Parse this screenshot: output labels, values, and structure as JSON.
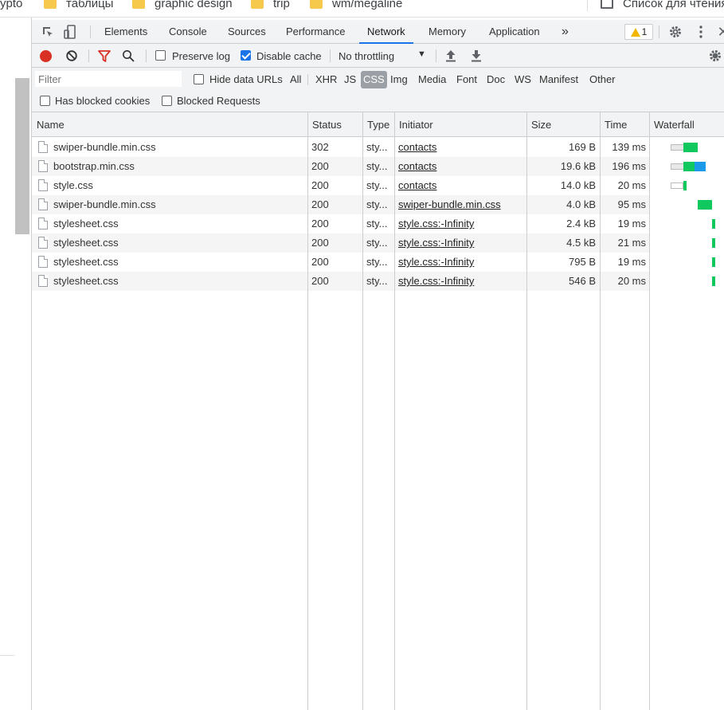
{
  "bookmarks": [
    {
      "label": "ypto",
      "folder": false
    },
    {
      "label": "таблицы",
      "folder": true
    },
    {
      "label": "graphic design",
      "folder": true
    },
    {
      "label": "trip",
      "folder": true
    },
    {
      "label": "wm/megaline",
      "folder": true
    }
  ],
  "reading_list": {
    "label": "Список для чтения"
  },
  "devtools": {
    "tabs": [
      "Elements",
      "Console",
      "Sources",
      "Performance",
      "Network",
      "Memory",
      "Application"
    ],
    "active_tab": "Network",
    "more_tabs": "»",
    "warnings_count": "1",
    "toolbar": {
      "preserve_log": "Preserve log",
      "preserve_log_checked": false,
      "disable_cache": "Disable cache",
      "disable_cache_checked": true,
      "throttling": "No throttling"
    },
    "filter": {
      "placeholder": "Filter",
      "hide_data_urls": "Hide data URLs",
      "types": [
        "All",
        "XHR",
        "JS",
        "CSS",
        "Img",
        "Media",
        "Font",
        "Doc",
        "WS",
        "Manifest",
        "Other"
      ],
      "active_type": "CSS",
      "has_blocked_cookies": "Has blocked cookies",
      "blocked_requests": "Blocked Requests"
    },
    "columns": [
      "Name",
      "Status",
      "Type",
      "Initiator",
      "Size",
      "Time",
      "Waterfall"
    ],
    "rows": [
      {
        "name": "swiper-bundle.min.css",
        "status": "302",
        "type": "sty...",
        "initiator": "contacts",
        "size": "169 B",
        "time": "139 ms"
      },
      {
        "name": "bootstrap.min.css",
        "status": "200",
        "type": "sty...",
        "initiator": "contacts",
        "size": "19.6 kB",
        "time": "196 ms"
      },
      {
        "name": "style.css",
        "status": "200",
        "type": "sty...",
        "initiator": "contacts",
        "size": "14.0 kB",
        "time": "20 ms"
      },
      {
        "name": "swiper-bundle.min.css",
        "status": "200",
        "type": "sty...",
        "initiator": "swiper-bundle.min.css",
        "size": "4.0 kB",
        "time": "95 ms"
      },
      {
        "name": "stylesheet.css",
        "status": "200",
        "type": "sty...",
        "initiator": "style.css:-Infinity",
        "size": "2.4 kB",
        "time": "19 ms"
      },
      {
        "name": "stylesheet.css",
        "status": "200",
        "type": "sty...",
        "initiator": "style.css:-Infinity",
        "size": "4.5 kB",
        "time": "21 ms"
      },
      {
        "name": "stylesheet.css",
        "status": "200",
        "type": "sty...",
        "initiator": "style.css:-Infinity",
        "size": "795 B",
        "time": "19 ms"
      },
      {
        "name": "stylesheet.css",
        "status": "200",
        "type": "sty...",
        "initiator": "style.css:-Infinity",
        "size": "546 B",
        "time": "20 ms"
      }
    ],
    "colors": {
      "accent": "#1a73e8",
      "record": "#d93025",
      "waterfall_green": "#0fc95f",
      "waterfall_blue": "#1a9ae8",
      "warning": "#f2b600"
    }
  }
}
